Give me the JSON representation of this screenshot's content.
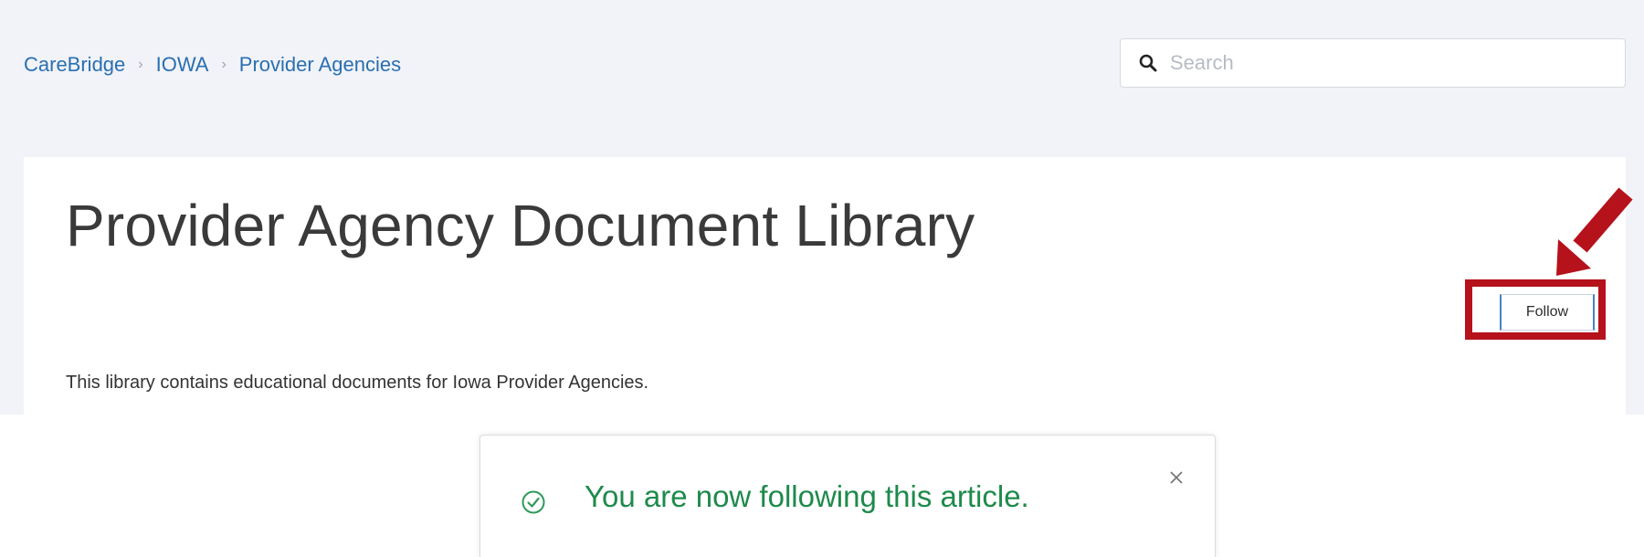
{
  "breadcrumb": {
    "items": [
      "CareBridge",
      "IOWA",
      "Provider Agencies"
    ],
    "separator": "›"
  },
  "search": {
    "placeholder": "Search",
    "value": ""
  },
  "page": {
    "title": "Provider Agency Document Library",
    "description": "This library contains educational documents for Iowa Provider Agencies."
  },
  "actions": {
    "follow_label": "Follow"
  },
  "annotation": {
    "arrow_icon": "red-arrow-down-left-icon",
    "highlight_color": "#b5121b"
  },
  "toast": {
    "message": "You are now following this article.",
    "icon": "check-circle-icon",
    "close_icon": "close-icon",
    "color": "#1e8a4c"
  },
  "colors": {
    "link": "#2a6fb0",
    "background": "#f1f3f8",
    "follow_border": "#4a82c4"
  }
}
